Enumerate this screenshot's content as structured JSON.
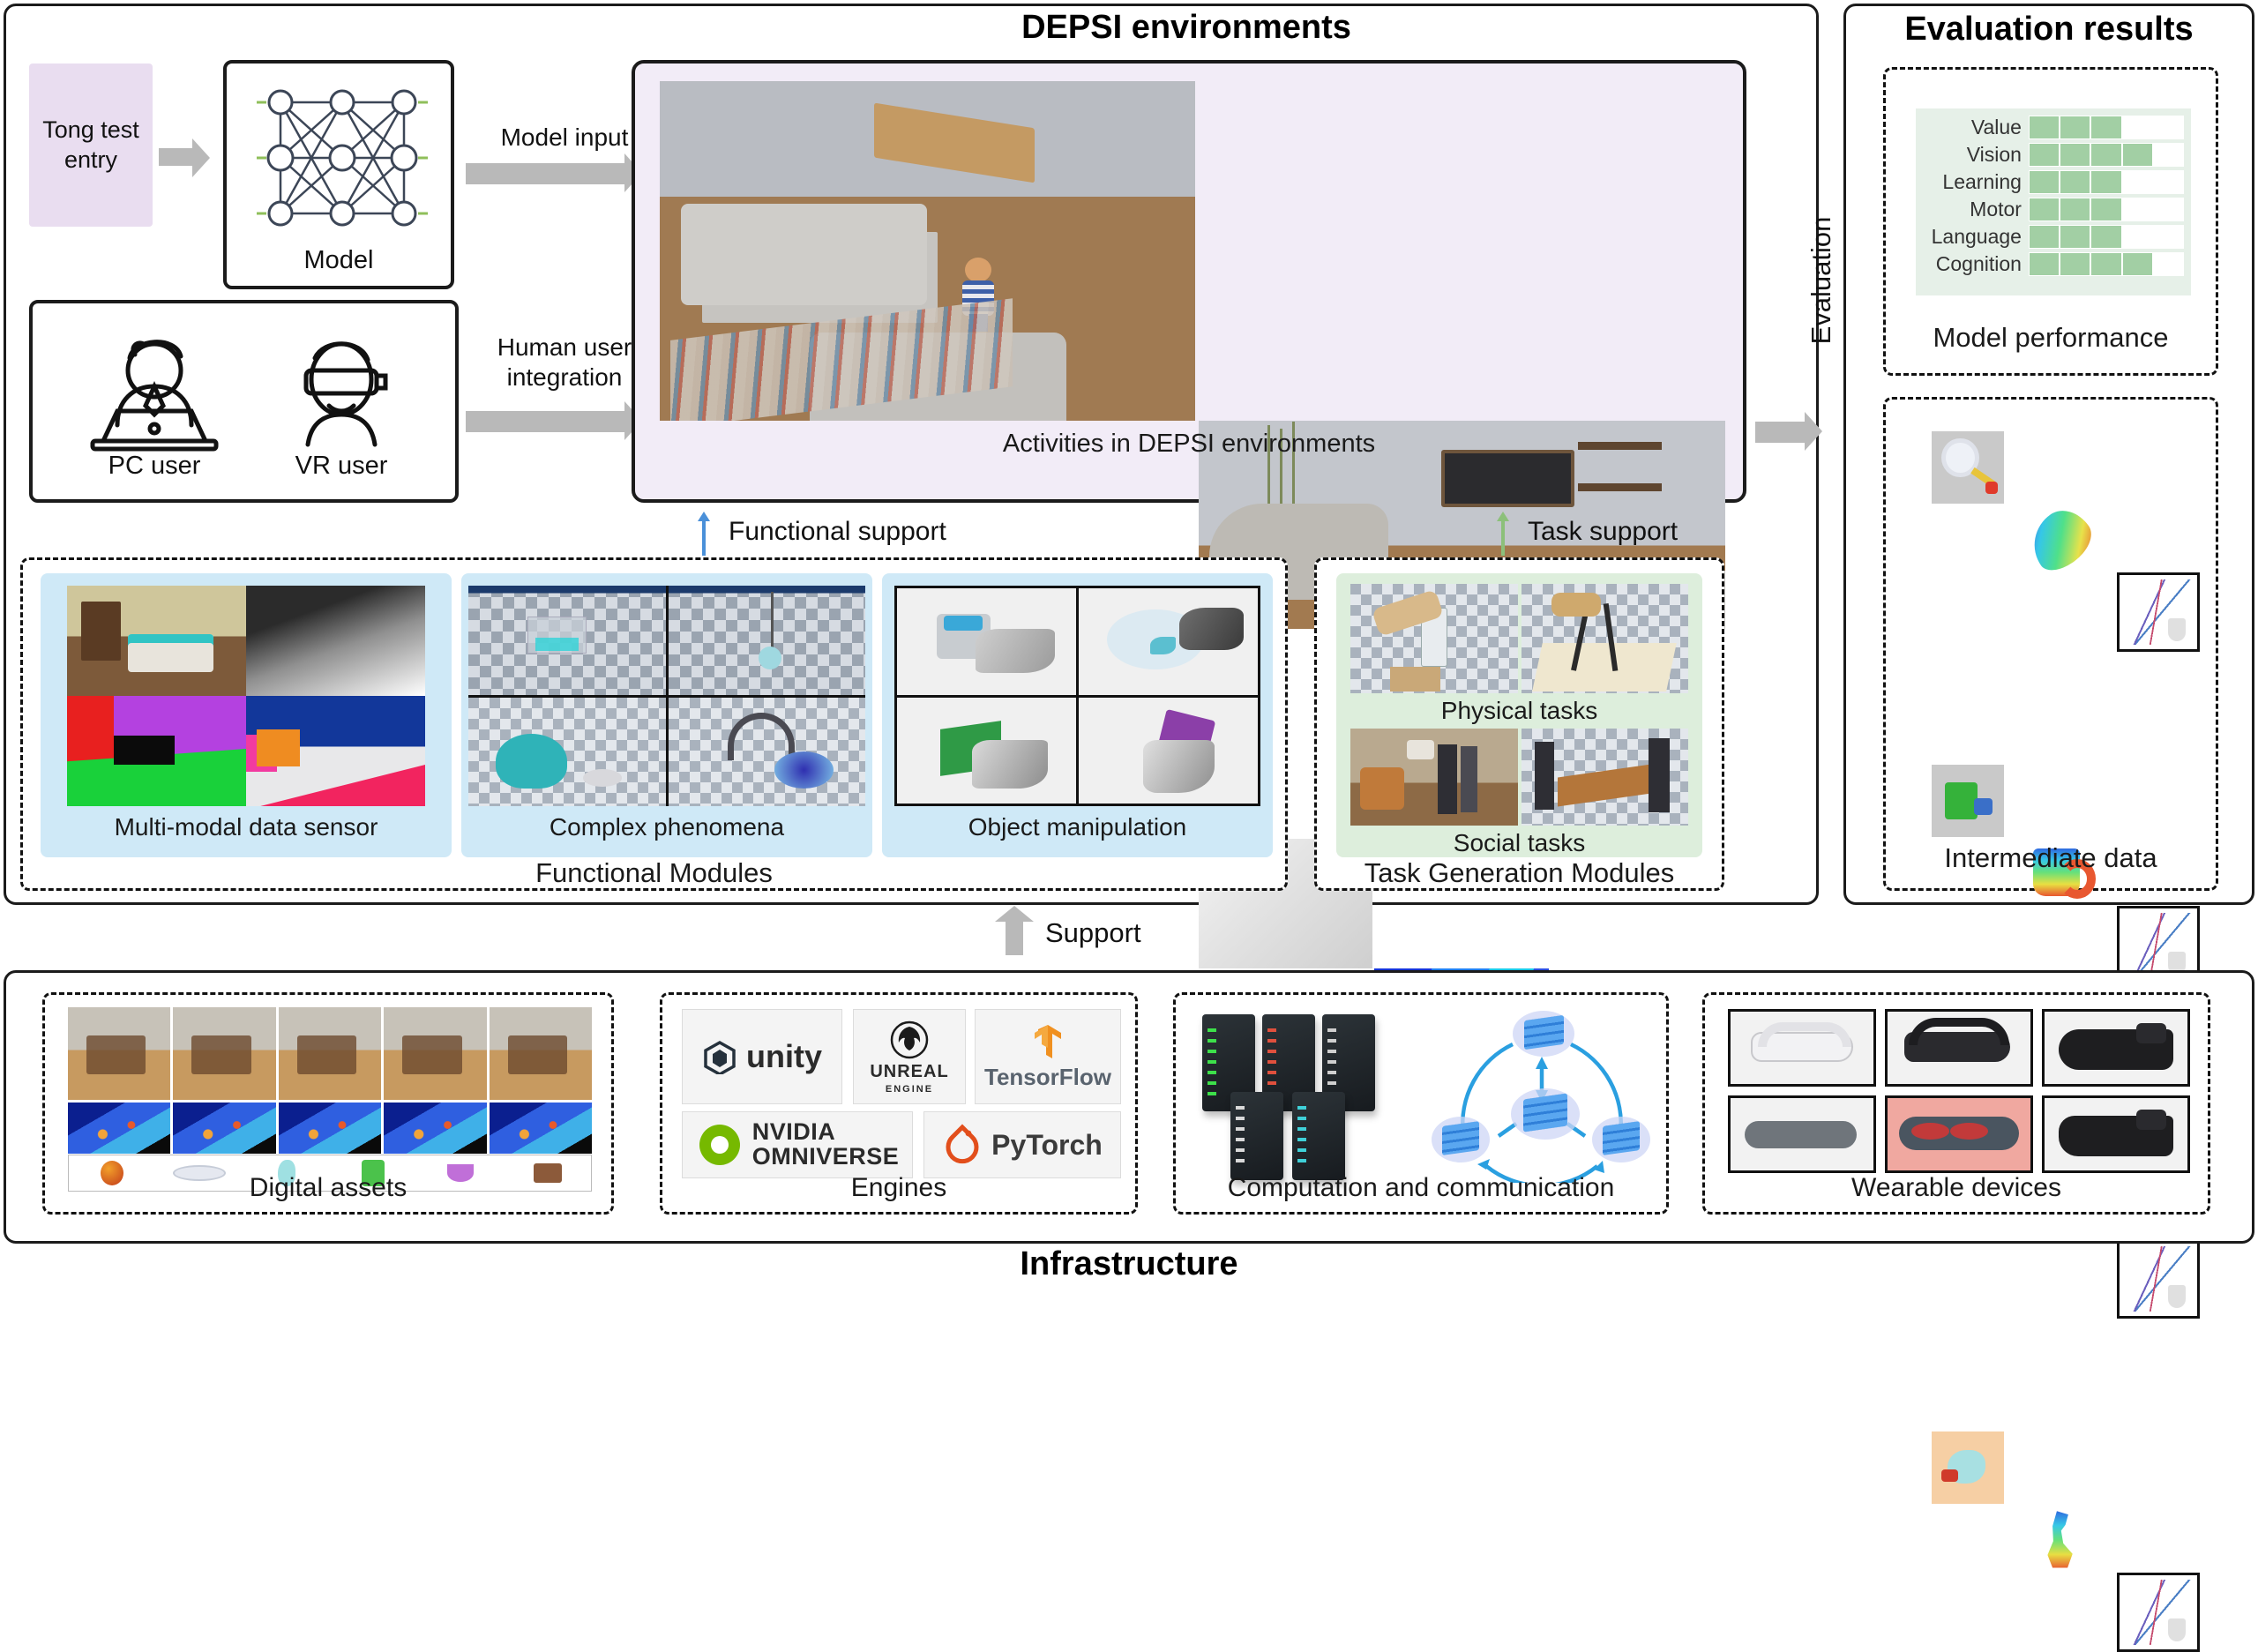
{
  "diagram": {
    "title_depsi": "DEPSI environments",
    "title_evaluation": "Evaluation results",
    "title_infrastructure": "Infrastructure"
  },
  "left_inputs": {
    "entry_label": "Tong test entry",
    "model_label": "Model",
    "pc_user_label": "PC user",
    "vr_user_label": "VR user",
    "model_input_arrow": "Model input",
    "human_user_arrow": "Human user\nintegration",
    "human_user_line1": "Human user",
    "human_user_line2": "integration"
  },
  "depsi": {
    "caption": "Activities in DEPSI environments",
    "functional_support_label": "Functional support",
    "task_support_label": "Task support",
    "functional_support_color": "#4a90d9",
    "task_support_color": "#8cc07a"
  },
  "functional_modules": {
    "group_label": "Functional Modules",
    "cards": [
      {
        "label": "Multi-modal data sensor"
      },
      {
        "label": "Complex phenomena"
      },
      {
        "label": "Object manipulation"
      }
    ],
    "card_bg": "#cfe9f7"
  },
  "task_modules": {
    "group_label": "Task Generation Modules",
    "cards": [
      {
        "label": "Physical tasks"
      },
      {
        "label": "Social tasks"
      }
    ],
    "card_bg": "#ddeedc"
  },
  "evaluation": {
    "arrow_label": "Evaluation",
    "model_performance_label": "Model performance",
    "intermediate_data_label": "Intermediate data",
    "chart_accent": "#a2cfa4",
    "chart_bg": "#e6f0e8"
  },
  "chart_data": {
    "type": "bar",
    "title": "Model performance",
    "categories": [
      "Value",
      "Vision",
      "Learning",
      "Motor",
      "Language",
      "Cognition"
    ],
    "values": [
      3,
      4,
      3,
      3,
      3,
      4
    ],
    "max_cells": 5,
    "xlabel": "",
    "ylabel": "",
    "ylim": [
      0,
      5
    ],
    "orientation": "horizontal",
    "filled_color": "#a2cfa4",
    "empty_color": "#ffffff",
    "panel_color": "#e6f0e8",
    "grid": false,
    "legend": "none"
  },
  "support_arrow": {
    "label": "Support"
  },
  "infrastructure": {
    "cards": [
      {
        "label": "Digital assets"
      },
      {
        "label": "Engines"
      },
      {
        "label": "Computation and communication"
      },
      {
        "label": "Wearable devices"
      }
    ],
    "engines": [
      {
        "name": "unity",
        "icon": "unity-icon"
      },
      {
        "name": "UNREAL",
        "sub": "ENGINE",
        "icon": "unreal-icon"
      },
      {
        "name": "TensorFlow",
        "icon": "tensorflow-icon"
      },
      {
        "name": "NVIDIA",
        "sub": "OMNIVERSE",
        "icon": "nvidia-icon"
      },
      {
        "name": "PyTorch",
        "icon": "pytorch-icon"
      }
    ]
  }
}
